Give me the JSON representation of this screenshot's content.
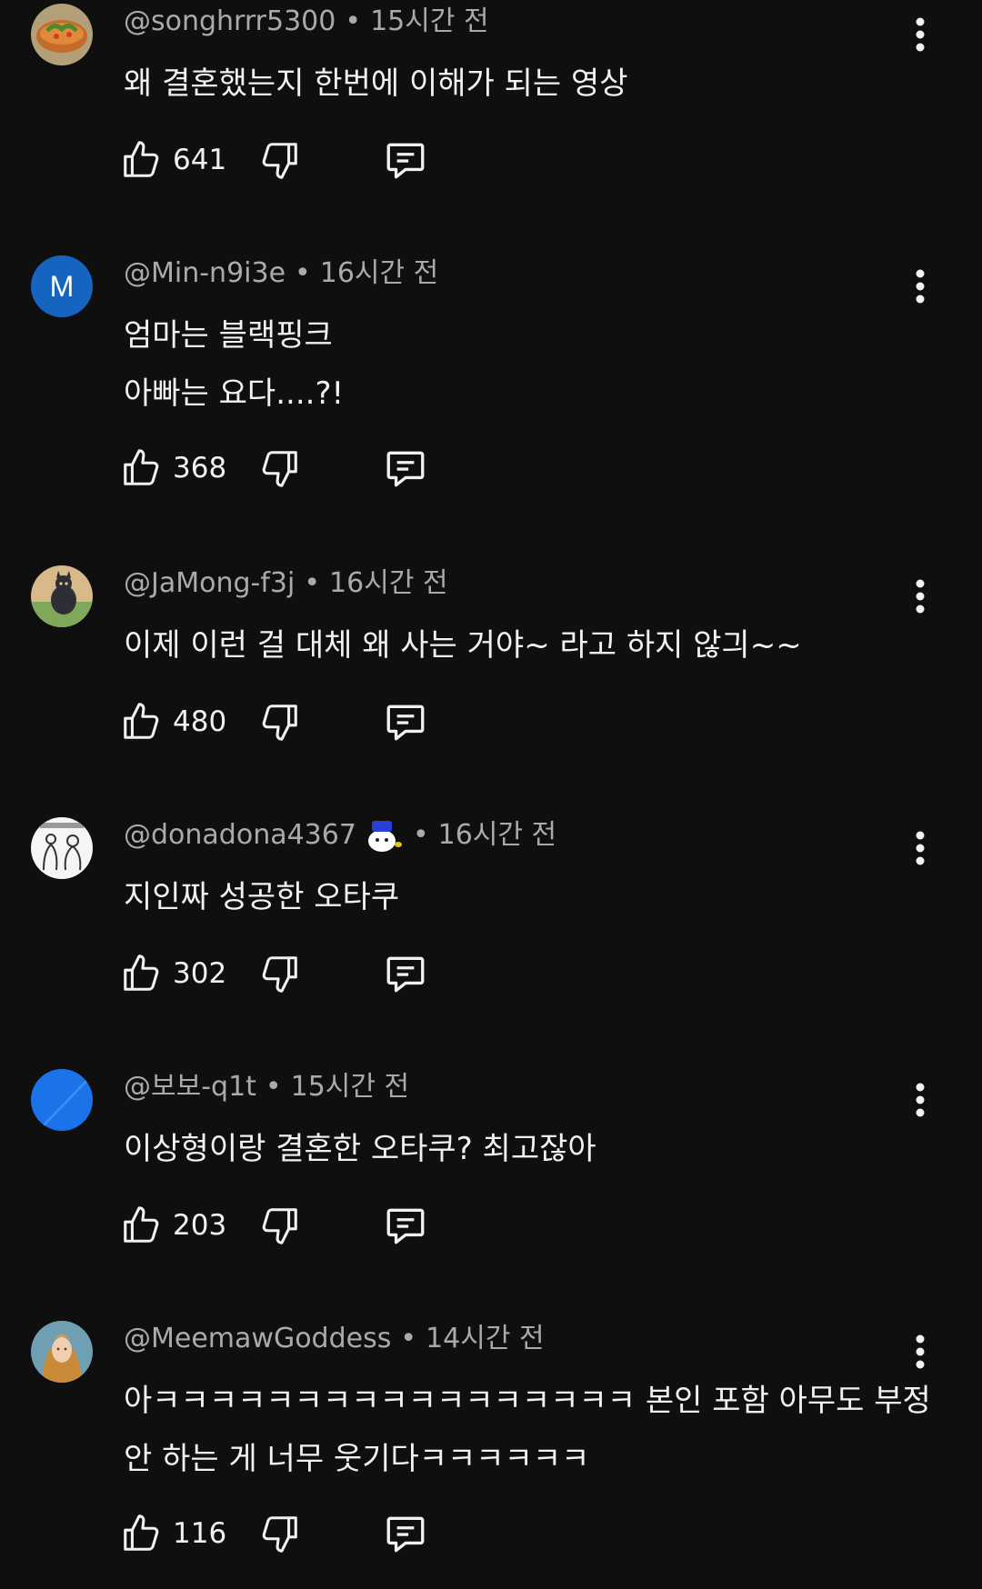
{
  "separator": "•",
  "comments": [
    {
      "author": "@songhrrr5300",
      "time": "15시간 전",
      "lines": [
        "왜 결혼했는지 한번에 이해가 되는 영상"
      ],
      "likes": "641",
      "avatar": "food-avatar"
    },
    {
      "author": "@Min-n9i3e",
      "time": "16시간 전",
      "lines": [
        "엄마는 블랙핑크",
        "아빠는 요다....?!"
      ],
      "likes": "368",
      "avatar_letter": "M",
      "avatar_color": "#1565c0"
    },
    {
      "author": "@JaMong-f3j",
      "time": "16시간 전",
      "lines": [
        "이제 이런 걸 대체 왜 사는 거야~ 라고 하지 않긔~~"
      ],
      "likes": "480",
      "avatar": "cat-avatar"
    },
    {
      "author": "@donadona4367",
      "time": "16시간 전",
      "lines": [
        "지인짜 성공한 오타쿠"
      ],
      "likes": "302",
      "avatar": "sketch-avatar",
      "badge": "member-badge-icon"
    },
    {
      "author": "@보보-q1t",
      "time": "15시간 전",
      "lines": [
        "이상형이랑 결혼한 오타쿠? 최고잖아"
      ],
      "likes": "203",
      "avatar_color": "#1a73e8"
    },
    {
      "author": "@MeemawGoddess",
      "time": "14시간 전",
      "lines": [
        "아ㅋㅋㅋㅋㅋㅋㅋㅋㅋㅋㅋㅋㅋㅋㅋㅋㅋ 본인 포함 아무도 부정",
        "안 하는 게 너무 웃기다ㅋㅋㅋㅋㅋㅋ"
      ],
      "likes": "116",
      "avatar": "painting-avatar"
    }
  ],
  "icons": {
    "like": "thumbs-up-icon",
    "dislike": "thumbs-down-icon",
    "reply": "reply-icon",
    "more": "more-vert-icon"
  }
}
